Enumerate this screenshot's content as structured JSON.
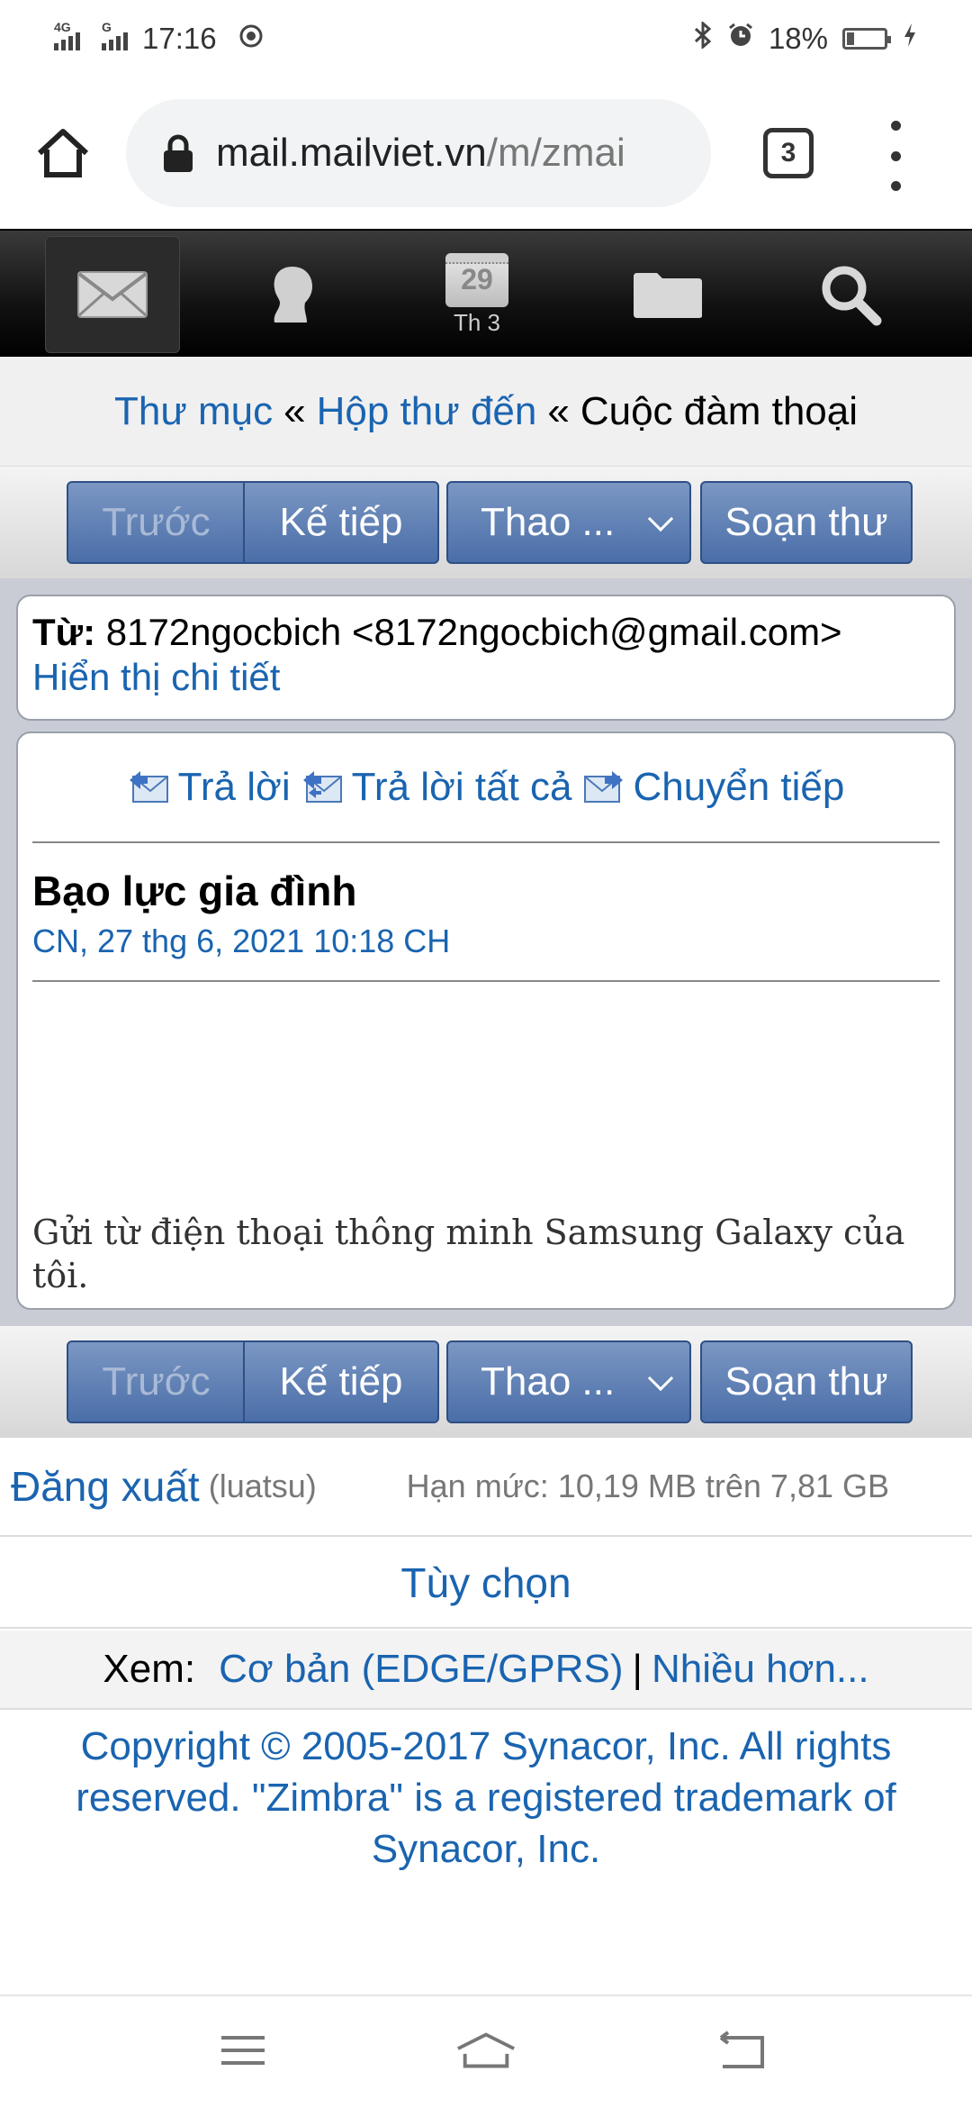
{
  "status_bar": {
    "network_1": "4G",
    "network_2": "G",
    "time": "17:16",
    "battery": "18%",
    "battery_level": 0.18,
    "icons": [
      "signal-icon",
      "signal-icon",
      "app-notification-icon",
      "bluetooth-icon",
      "alarm-icon",
      "battery-icon",
      "charging-icon"
    ]
  },
  "browser": {
    "url_host": "mail.mailviet.vn",
    "url_path": "/m/zmai",
    "tab_count": "3",
    "icons": [
      "home-icon",
      "lock-icon",
      "tabs-icon",
      "overflow-menu-icon"
    ]
  },
  "app_toolbar": {
    "calendar_day": "29",
    "calendar_month": "Th 3",
    "icons": [
      "mail-icon",
      "contacts-icon",
      "calendar-icon",
      "folder-icon",
      "search-icon"
    ]
  },
  "breadcrumb": {
    "folders": "Thư mục",
    "inbox": "Hộp thư đến",
    "separator": "«",
    "current": "Cuộc đàm thoại"
  },
  "buttons": {
    "prev": "Trước",
    "next": "Kế tiếp",
    "actions": "Thao ...",
    "compose": "Soạn thư"
  },
  "message": {
    "from_label": "Từ:",
    "from_value": "8172ngocbich <8172ngocbich@gmail.com>",
    "show_details": "Hiển thị chi tiết",
    "reply": "Trả lời",
    "reply_all": "Trả lời tất cả",
    "forward": "Chuyển tiếp",
    "subject": "Bạo lực gia đình",
    "date": "CN, 27 thg 6, 2021 10:18 CH",
    "body": "Gửi từ điện thoại thông minh Samsung Galaxy của tôi."
  },
  "footer": {
    "logout": "Đăng xuất",
    "username": "(luatsu)",
    "quota": "Hạn mức: 10,19 MB trên 7,81 GB",
    "options": "Tùy chọn",
    "view_label": "Xem:",
    "view_basic": "Cơ bản (EDGE/GPRS)",
    "view_separator": "|",
    "view_more": "Nhiều hơn...",
    "copyright": "Copyright © 2005-2017 Synacor, Inc. All rights reserved. \"Zimbra\" is a registered trademark of Synacor, Inc."
  },
  "nav_bar": {
    "icons": [
      "recents-icon",
      "home-icon",
      "back-icon"
    ]
  }
}
